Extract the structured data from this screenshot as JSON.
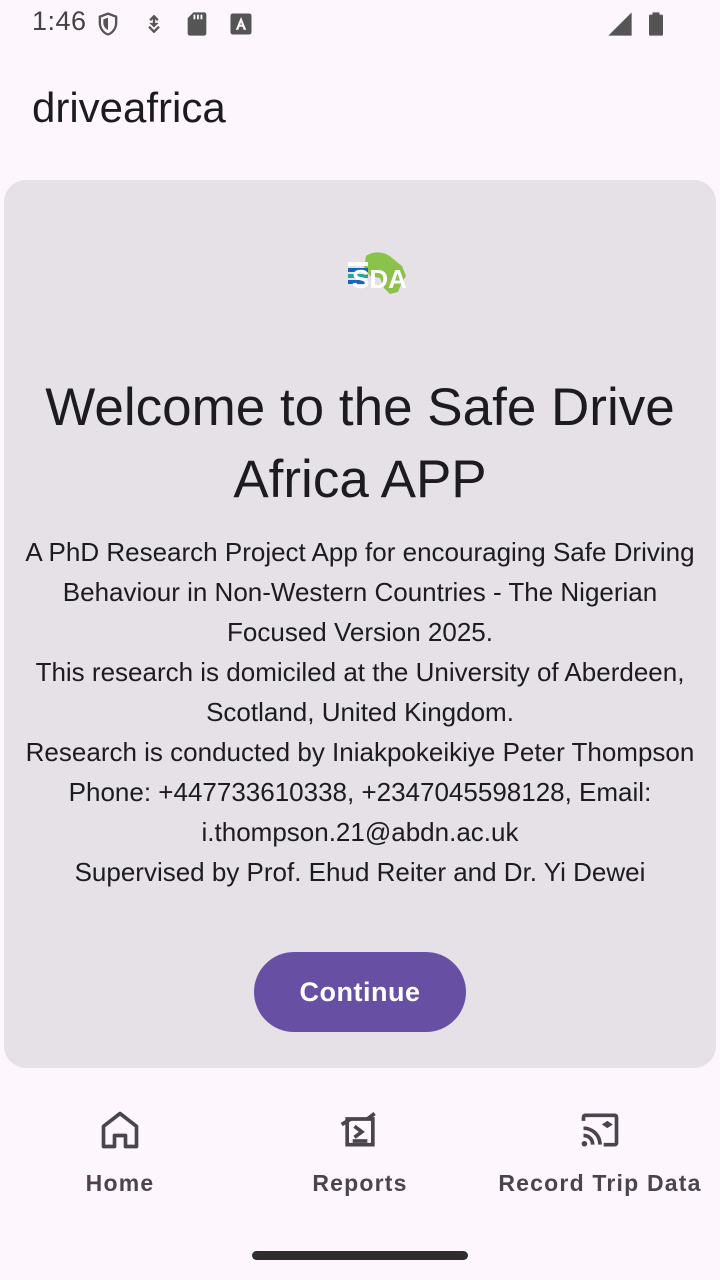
{
  "status_bar": {
    "time": "1:46",
    "icons": [
      "shield-icon",
      "download-icon",
      "sd-card-icon",
      "font-a-icon",
      "signal-icon",
      "battery-icon"
    ]
  },
  "app_bar": {
    "title": "driveafrica"
  },
  "card": {
    "logo_text": "SDA",
    "welcome_title": "Welcome to the Safe Drive Africa APP",
    "description_lines": [
      "A PhD Research Project App for encouraging Safe Driving Behaviour in Non-Western Countries - The Nigerian Focused Version 2025.",
      "This research is domiciled at the University of Aberdeen, Scotland, United Kingdom.",
      "Research is conducted by Iniakpokeikiye Peter Thompson",
      "Phone: +447733610338, +2347045598128, Email: i.thompson.21@abdn.ac.uk",
      "Supervised by Prof. Ehud Reiter and Dr. Yi Dewei"
    ],
    "continue_label": "Continue"
  },
  "bottom_nav": {
    "items": [
      {
        "label": "Home",
        "icon": "home-icon"
      },
      {
        "label": "Reports",
        "icon": "reports-icon"
      },
      {
        "label": "Record Trip Data",
        "icon": "record-trip-icon"
      }
    ]
  },
  "colors": {
    "background": "#fdf7fd",
    "card": "#e5e1e7",
    "primary": "#6750a4",
    "text": "#1c1b1f",
    "nav_text": "#49454f"
  }
}
